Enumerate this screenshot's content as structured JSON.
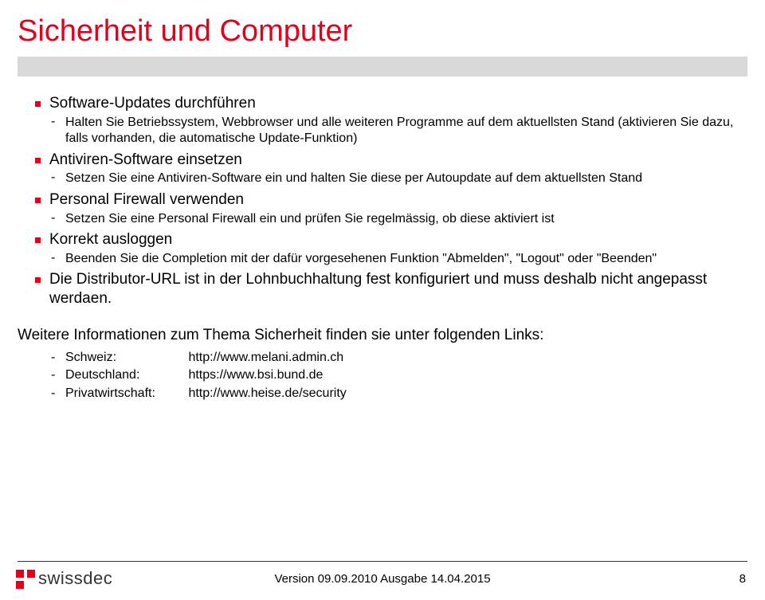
{
  "title": "Sicherheit und Computer",
  "items": [
    {
      "heading": "Software-Updates durchführen",
      "sub": "Halten Sie Betriebssystem, Webbrowser und alle weiteren Programme auf dem aktuellsten Stand (aktivieren Sie dazu, falls vorhanden, die automatische Update-Funktion)"
    },
    {
      "heading": "Antiviren-Software einsetzen",
      "sub": "Setzen Sie eine Antiviren-Software ein und halten Sie diese per Autoupdate auf dem aktuellsten Stand"
    },
    {
      "heading": "Personal Firewall verwenden",
      "sub": "Setzen Sie eine Personal Firewall ein und prüfen Sie regelmässig, ob diese aktiviert ist"
    },
    {
      "heading": "Korrekt ausloggen",
      "sub": "Beenden Sie die Completion mit der dafür vorgesehenen Funktion \"Abmelden\", \"Logout\" oder \"Beenden\""
    },
    {
      "heading": "Die Distributor-URL ist in der Lohnbuchhaltung fest konfiguriert und muss deshalb nicht angepasst werdaen."
    }
  ],
  "more_info": "Weitere Informationen zum Thema Sicherheit finden sie unter folgenden Links:",
  "links": [
    {
      "label": "Schweiz:",
      "url": "http://www.melani.admin.ch"
    },
    {
      "label": "Deutschland:",
      "url": "https://www.bsi.bund.de"
    },
    {
      "label": "Privatwirtschaft:",
      "url": "http://www.heise.de/security"
    }
  ],
  "footer": {
    "logo_text": "swissdec",
    "version": "Version 09.09.2010 Ausgabe 14.04.2015",
    "page": "8"
  }
}
